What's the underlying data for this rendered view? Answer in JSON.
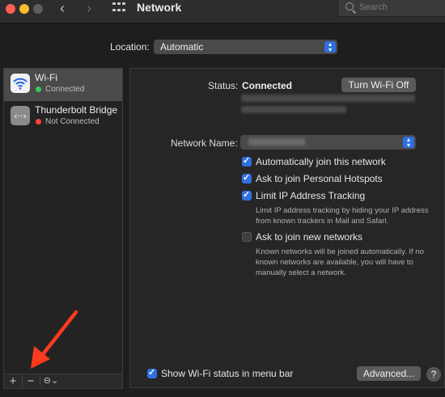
{
  "window": {
    "title": "Network"
  },
  "search": {
    "placeholder": "Search"
  },
  "location": {
    "label": "Location:",
    "value": "Automatic"
  },
  "sidebar": {
    "items": [
      {
        "name": "Wi-Fi",
        "status": "Connected",
        "status_color": "#35c759"
      },
      {
        "name": "Thunderbolt Bridge",
        "status": "Not Connected",
        "status_color": "#ff453a"
      }
    ]
  },
  "bottom_bar": {
    "add": "+",
    "remove": "−",
    "action": "⊖⌄"
  },
  "wifi": {
    "status_label": "Status:",
    "status_value": "Connected",
    "turn_off_button": "Turn Wi-Fi Off",
    "network_name_label": "Network Name:",
    "options": [
      {
        "label": "Automatically join this network",
        "checked": true
      },
      {
        "label": "Ask to join Personal Hotspots",
        "checked": true
      },
      {
        "label": "Limit IP Address Tracking",
        "checked": true
      },
      {
        "label": "Ask to join new networks",
        "checked": false
      }
    ],
    "limit_help": "Limit IP address tracking by hiding your IP address from known trackers in Mail and Safari.",
    "new_networks_help": "Known networks will be joined automatically. If no known networks are available, you will have to manually select a network."
  },
  "footer": {
    "show_status_label": "Show Wi-Fi status in menu bar",
    "show_status_checked": true,
    "advanced_button": "Advanced...",
    "help": "?"
  },
  "colors": {
    "accent": "#2f6fe0",
    "annotation_arrow": "#ff3b1f"
  }
}
